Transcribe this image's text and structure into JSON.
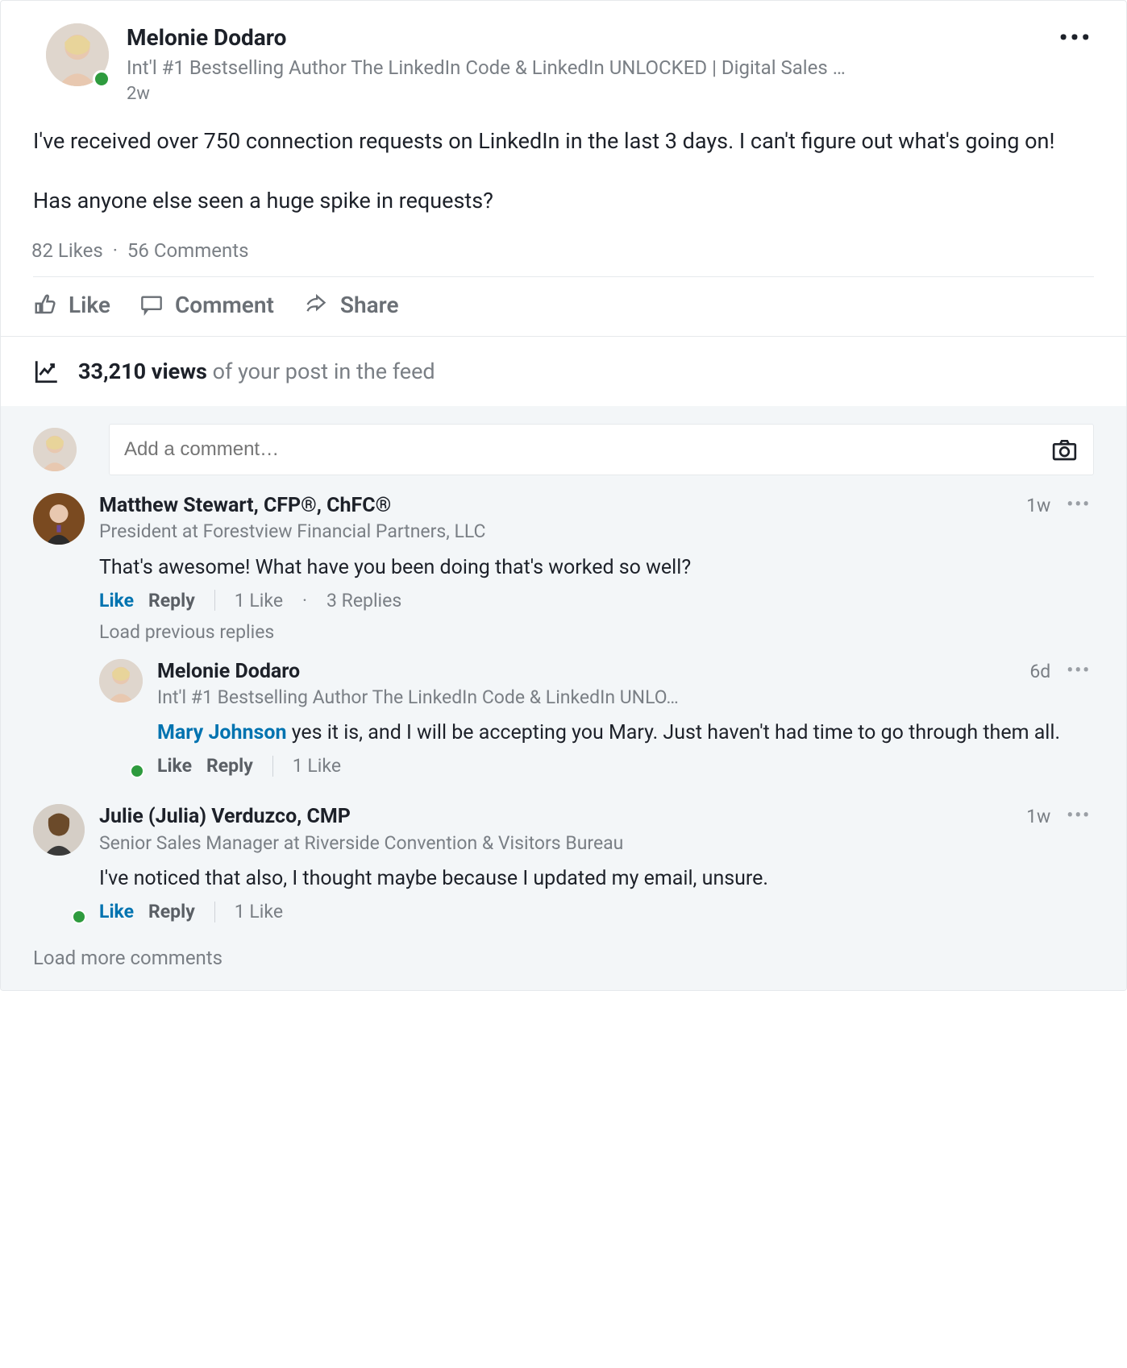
{
  "post": {
    "author": {
      "name": "Melonie Dodaro",
      "subtitle": "Int'l #1 Bestselling Author The LinkedIn Code & LinkedIn UNLOCKED | Digital Sales …",
      "time": "2w",
      "presence": "online"
    },
    "body_p1": "I've received over 750 connection requests on LinkedIn in the last 3 days. I can't figure out what's going on!",
    "body_p2": "Has anyone else seen a huge spike in requests?",
    "likes_label": "82 Likes",
    "comments_label": "56 Comments",
    "actions": {
      "like": "Like",
      "comment": "Comment",
      "share": "Share"
    },
    "views_count": "33,210 views",
    "views_suffix": " of your post in the feed"
  },
  "comment_input": {
    "placeholder": "Add a comment…"
  },
  "comments": [
    {
      "name": "Matthew Stewart, CFP®, ChFC®",
      "subtitle": "President at Forestview Financial Partners, LLC",
      "time": "1w",
      "text": "That's awesome! What have you been doing that's worked so well?",
      "like_state": "blue",
      "like_label": "Like",
      "reply_label": "Reply",
      "stats_likes": "1 Like",
      "stats_replies": "3 Replies",
      "load_prev": "Load previous replies",
      "replies": [
        {
          "name": "Melonie Dodaro",
          "subtitle": "Int'l #1 Bestselling Author The LinkedIn Code & LinkedIn UNLO…",
          "time": "6d",
          "mention": "Mary Johnson",
          "text_rest": " yes it is, and I will be accepting you Mary. Just haven't had time to go through them all.",
          "like_label": "Like",
          "reply_label": "Reply",
          "stats_likes": "1 Like"
        }
      ]
    },
    {
      "name": "Julie (Julia) Verduzco, CMP",
      "subtitle": "Senior Sales Manager at Riverside Convention & Visitors Bureau",
      "time": "1w",
      "text": "I've noticed that also, I thought maybe because I updated my email, unsure.",
      "like_state": "blue",
      "like_label": "Like",
      "reply_label": "Reply",
      "stats_likes": "1 Like"
    }
  ],
  "load_more": "Load more comments",
  "icons": {
    "more": "more-icon",
    "like": "thumb-up-icon",
    "comment": "comment-icon",
    "share": "share-icon",
    "analytics": "analytics-icon",
    "camera": "camera-icon"
  },
  "colors": {
    "text": "#1d2129",
    "muted": "#7a7f85",
    "link": "#0073b0",
    "presence": "#2e9b3e",
    "comment_bg": "#f3f6f8",
    "border": "#e6e9ec"
  }
}
